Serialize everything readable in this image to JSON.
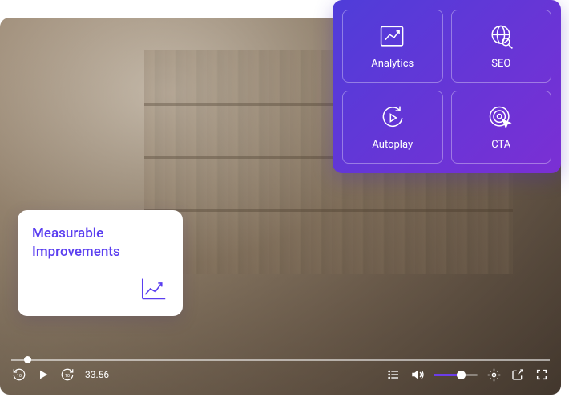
{
  "player": {
    "time": "33.56"
  },
  "features": {
    "tiles": [
      {
        "label": "Analytics",
        "icon": "analytics"
      },
      {
        "label": "SEO",
        "icon": "seo"
      },
      {
        "label": "Autoplay",
        "icon": "autoplay"
      },
      {
        "label": "CTA",
        "icon": "cta"
      }
    ]
  },
  "callout": {
    "title": "Measurable Improvements"
  },
  "colors": {
    "accent": "#5a3ef0",
    "gradient_start": "#4f3dd9",
    "gradient_end": "#7b2fd4"
  }
}
